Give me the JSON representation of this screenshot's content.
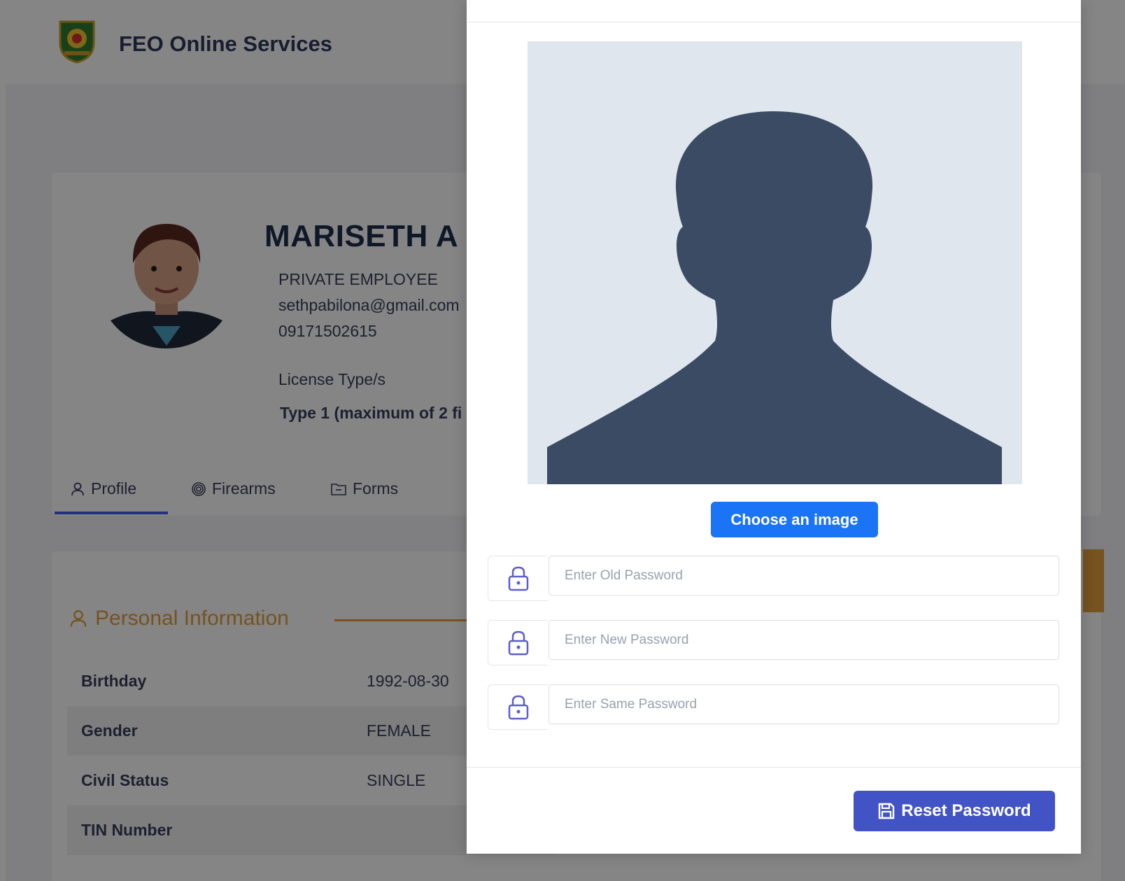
{
  "navbar": {
    "brand": "FEO Online Services",
    "logo_icon": "seal-logo"
  },
  "profile": {
    "name": "MARISETH A",
    "occupation": "PRIVATE EMPLOYEE",
    "email": "sethpabilona@gmail.com",
    "phone": "09171502615",
    "license_label": "License Type/s",
    "license_value": "Type 1 (maximum of 2 fi"
  },
  "tabs": [
    {
      "label": "Profile",
      "icon": "user-icon",
      "active": true
    },
    {
      "label": "Firearms",
      "icon": "target-icon",
      "active": false
    },
    {
      "label": "Forms",
      "icon": "folder-icon",
      "active": false
    }
  ],
  "personal": {
    "heading": "Personal Information",
    "rows": [
      {
        "label": "Birthday",
        "value": "1992-08-30"
      },
      {
        "label": "Gender",
        "value": "FEMALE"
      },
      {
        "label": "Civil Status",
        "value": "SINGLE"
      },
      {
        "label": "TIN Number",
        "value": ""
      }
    ]
  },
  "modal": {
    "choose_label": "Choose an image",
    "old_password_placeholder": "Enter Old Password",
    "new_password_placeholder": "Enter New Password",
    "same_password_placeholder": "Enter Same Password",
    "reset_label": "Reset Password"
  },
  "colors": {
    "accent": "#e2a03f",
    "primary": "#1b73f6",
    "reset": "#4254c5",
    "tab_underline": "#4361ee"
  }
}
